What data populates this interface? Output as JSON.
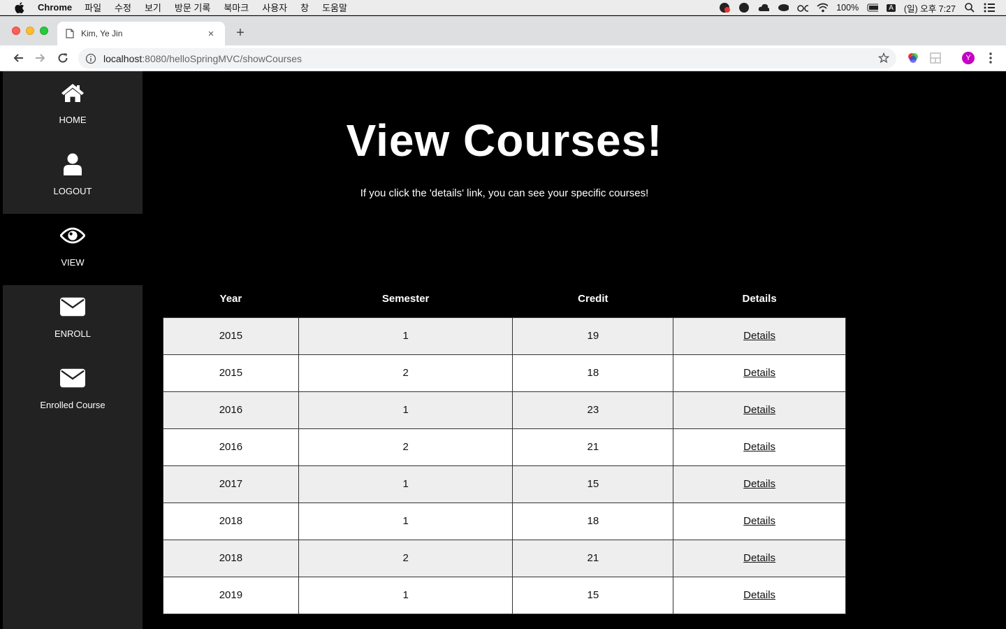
{
  "menubar": {
    "app_name": "Chrome",
    "menus": [
      "파일",
      "수정",
      "보기",
      "방문 기록",
      "북마크",
      "사용자",
      "창",
      "도움말"
    ],
    "battery": "100%",
    "input_source": "A",
    "clock": "(일) 오후 7:27"
  },
  "tab": {
    "title": "Kim, Ye Jin",
    "close_label": "×",
    "new_tab_label": "+"
  },
  "address_bar": {
    "host": "localhost",
    "rest": ":8080/helloSpringMVC/showCourses"
  },
  "profile": {
    "initial": "Y",
    "color": "#c300c3"
  },
  "sidebar": {
    "items": [
      {
        "label": "HOME",
        "icon": "home-icon"
      },
      {
        "label": "LOGOUT",
        "icon": "user-icon"
      },
      {
        "label": "VIEW",
        "icon": "eye-icon",
        "active": true
      },
      {
        "label": "ENROLL",
        "icon": "envelope-icon"
      },
      {
        "label": "Enrolled Course",
        "icon": "envelope-icon"
      }
    ]
  },
  "main": {
    "title": "View Courses!",
    "subtitle": "If you click the 'details' link, you can see your specific courses!"
  },
  "table": {
    "headers": [
      "Year",
      "Semester",
      "Credit",
      "Details"
    ],
    "rows": [
      {
        "year": "2015",
        "semester": "1",
        "credit": "19",
        "details": "Details"
      },
      {
        "year": "2015",
        "semester": "2",
        "credit": "18",
        "details": "Details"
      },
      {
        "year": "2016",
        "semester": "1",
        "credit": "23",
        "details": "Details"
      },
      {
        "year": "2016",
        "semester": "2",
        "credit": "21",
        "details": "Details"
      },
      {
        "year": "2017",
        "semester": "1",
        "credit": "15",
        "details": "Details"
      },
      {
        "year": "2018",
        "semester": "1",
        "credit": "18",
        "details": "Details"
      },
      {
        "year": "2018",
        "semester": "2",
        "credit": "21",
        "details": "Details"
      },
      {
        "year": "2019",
        "semester": "1",
        "credit": "15",
        "details": "Details"
      }
    ]
  }
}
